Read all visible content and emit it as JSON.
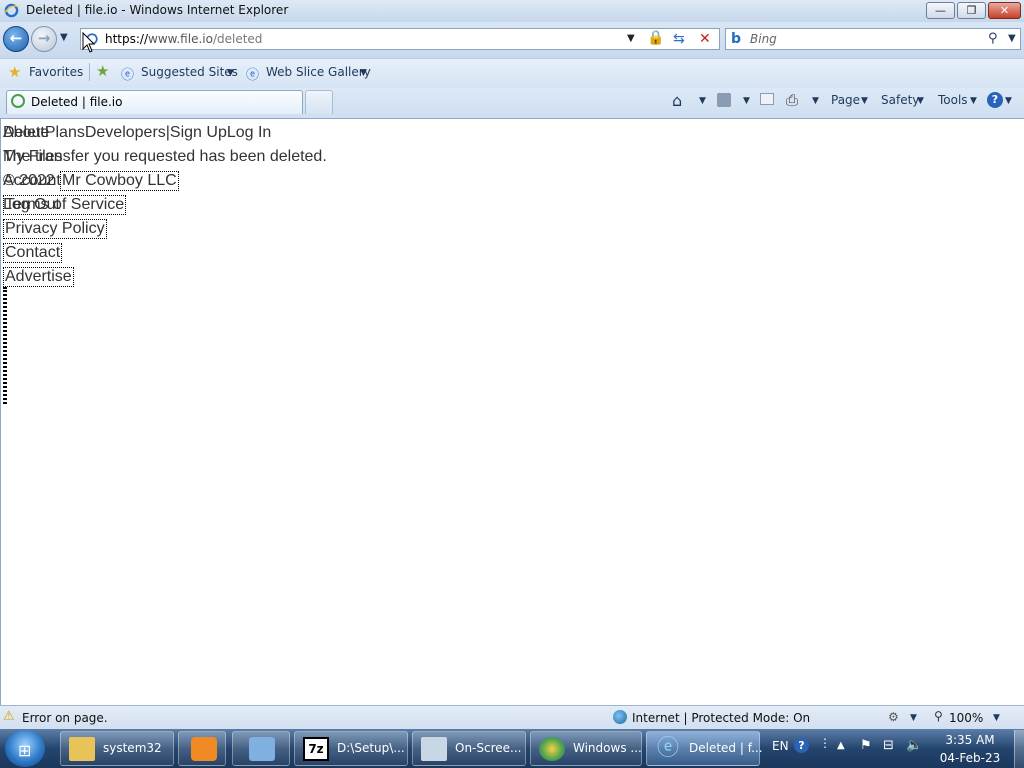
{
  "window": {
    "title": "Deleted | file.io - Windows Internet Explorer",
    "minimize_glyph": "—",
    "maximize_glyph": "❐",
    "close_glyph": "✕"
  },
  "address_bar": {
    "url_prefix": "https://",
    "url_host": "www.file.io",
    "url_path": "/deleted",
    "search_placeholder": "Bing"
  },
  "favorites_bar": {
    "favorites_label": "Favorites",
    "suggested_sites_label": "Suggested Sites",
    "web_slice_label": "Web Slice Gallery"
  },
  "tabs": {
    "active_tab_label": "Deleted | file.io"
  },
  "command_bar": {
    "page_label": "Page",
    "safety_label": "Safety",
    "tools_label": "Tools"
  },
  "page": {
    "nav_overlap_a": "AboutPlansDevelopers|Sign UpLog In",
    "nav_overlap_b": "Delete",
    "line2_a": "The transfer you requested has been deleted.",
    "line2_b": "My Files",
    "line3_a": "© 2022",
    "line3_b": "Account",
    "line3_link": "Mr Cowboy LLC",
    "line4_a": "Log Out",
    "line4_link": "Terms of Service",
    "privacy": "Privacy Policy",
    "contact": "Contact",
    "advertise": "Advertise"
  },
  "status_bar": {
    "error_text": "Error on page.",
    "zone_text": "Internet | Protected Mode: On",
    "zoom_text": "100%"
  },
  "taskbar": {
    "items": [
      {
        "label": "system32"
      },
      {
        "label": ""
      },
      {
        "label": ""
      },
      {
        "label": "D:\\Setup\\..."
      },
      {
        "label": "On-Scree..."
      },
      {
        "label": "Windows ..."
      },
      {
        "label": "Deleted | f..."
      }
    ],
    "lang": "EN",
    "time": "3:35 AM",
    "date": "04-Feb-23"
  },
  "colors": {
    "title_gradient": "#c6d7ec",
    "taskbar": "#24456e",
    "link_text": "#333333"
  }
}
